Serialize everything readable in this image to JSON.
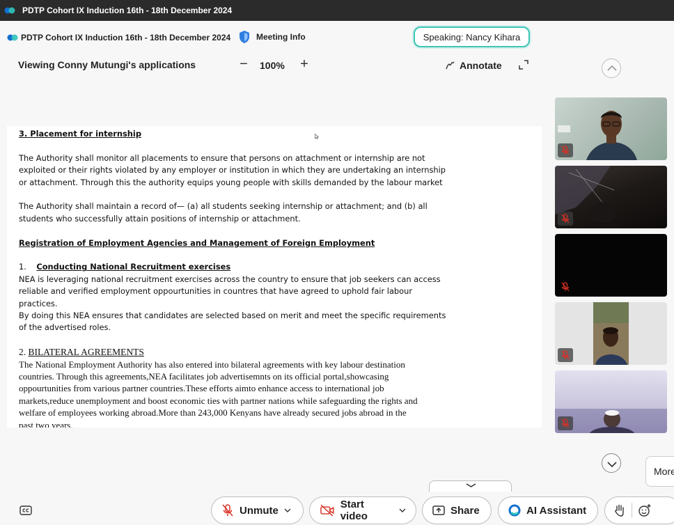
{
  "window": {
    "title": "PDTP Cohort IX Induction 16th - 18th December 2024"
  },
  "meeting": {
    "title": "PDTP Cohort IX Induction 16th - 18th December 2024",
    "info_label": "Meeting Info",
    "speaking": "Speaking: Nancy Kihara"
  },
  "share_bar": {
    "viewing": "Viewing Conny Mutungi's applications",
    "zoom_minus": "−",
    "zoom": "100%",
    "zoom_plus": "+",
    "annotate": "Annotate"
  },
  "document": {
    "heading1": "3. Placement for internship",
    "p1": [
      "The Authority shall monitor all placements to ensure that persons on attachment or internship are not",
      "exploited or their rights violated by any employer or institution in which they are undertaking an internship",
      "or attachment. Through this the authority equips young people with skills demanded by the labour market"
    ],
    "p2": [
      "The Authority shall maintain a record of— (a) all students seeking internship or attachment; and (b) all",
      "students who successfully attain positions of internship or attachment."
    ],
    "heading2": "Registration of Employment Agencies and Management of Foreign Employment",
    "item1_number": "1.",
    "item1_title": "Conducting National Recruitment exercises",
    "p3": [
      "NEA is leveraging national recruitment exercises across the country to ensure that job seekers can access",
      "reliable and verified employment oppourtunities in countres that have agreed to uphold fair labour",
      "practices.",
      "By doing this NEA ensures that candidates are selected based on merit and meet the specific requirements",
      "of the advertised roles."
    ],
    "item2_number": "2.",
    "item2_title": "BILATERAL AGREEMENTS",
    "p4": [
      "The National Employment Authority has also entered into bilateral agreements with key labour destination",
      "countries. Through this agreements,NEA facilitates job advertisemnts on its official portal,showcasing",
      "oppourtunities from various partner countries.These efforts aimto enhance access to international job",
      "markets,reduce unemployment and boost economic ties with partner nations while safeguarding the rights and",
      "welfare of employees working abroad.More than 243,000 Kenyans have already secured jobs abroad in the",
      "past two years."
    ]
  },
  "side_panel": {
    "more_label": "More"
  },
  "controls": {
    "unmute": "Unmute",
    "start_video": "Start video",
    "share": "Share",
    "ai_assistant": "AI Assistant"
  },
  "icons": {
    "app_logo": "webex-logo",
    "shield": "shield-icon",
    "annotate": "annotate-pen-icon",
    "fullscreen": "expand-icon",
    "cc": "closed-caption-icon",
    "mic_muted": "mic-muted-icon",
    "video_off": "video-off-icon",
    "share": "share-screen-icon",
    "ai": "ai-assistant-icon",
    "raise_hand": "raise-hand-icon",
    "reactions": "reactions-icon"
  },
  "colors": {
    "titlebar": "#2b2b2b",
    "speaking_border": "#3cc6b8",
    "muted_red": "#d93025",
    "ai_blue": "#1170cf"
  }
}
